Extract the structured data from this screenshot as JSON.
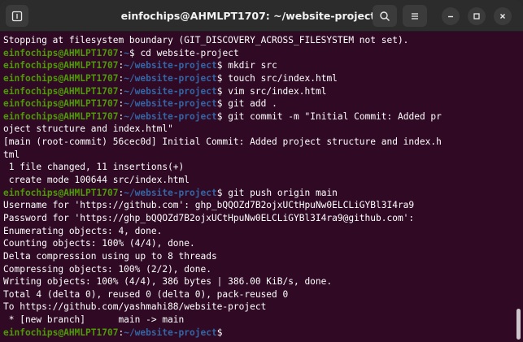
{
  "window": {
    "title": "einfochips@AHMLPT1707: ~/website-project",
    "icons": {
      "new_tab": "new-tab-icon",
      "search": "search-icon",
      "menu": "hamburger-menu-icon",
      "minimize": "minimize-icon",
      "maximize": "maximize-icon",
      "close": "close-icon"
    }
  },
  "colors": {
    "terminal_bg": "#300a24",
    "prompt_user": "#4e9a06",
    "prompt_path": "#3465a4",
    "text": "#ffffff"
  },
  "prompt": {
    "user_host": "einfochips@AHMLPT1707",
    "separator": ":",
    "path_home": "~",
    "path_project": "~/website-project",
    "dollar": "$ "
  },
  "terminal": {
    "lines": [
      {
        "text": "Stopping at filesystem boundary (GIT_DISCOVERY_ACROSS_FILESYSTEM not set)."
      },
      {
        "cmd": "cd website-project",
        "home": true
      },
      {
        "cmd": "mkdir src"
      },
      {
        "cmd": "touch src/index.html"
      },
      {
        "cmd": "vim src/index.html"
      },
      {
        "cmd": "git add ."
      },
      {
        "cmd": "git commit -m \"Initial Commit: Added pr"
      },
      {
        "text": "oject structure and index.html\""
      },
      {
        "text": "[main (root-commit) 56cec0d] Initial Commit: Added project structure and index.h"
      },
      {
        "text": "tml"
      },
      {
        "text": " 1 file changed, 11 insertions(+)"
      },
      {
        "text": " create mode 100644 src/index.html"
      },
      {
        "cmd": "git push origin main"
      },
      {
        "text": "Username for 'https://github.com': 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"
      },
      {
        "text": "Password for 'https://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@github.com':"
      },
      {
        "text": "Enumerating objects: 4, done."
      },
      {
        "text": "Counting objects: 100% (4/4), done."
      },
      {
        "text": "Delta compression using up to 8 threads"
      },
      {
        "text": "Compressing objects: 100% (2/2), done."
      },
      {
        "text": "Writing objects: 100% (4/4), 386 bytes | 386.00 KiB/s, done."
      },
      {
        "text": "Total 4 (delta 0), reused 0 (delta 0), pack-reused 0"
      },
      {
        "text": "To https://github.com/yashmahi88/website-project"
      },
      {
        "text": " * [new branch]      main -> main"
      },
      {
        "cmd": ""
      }
    ]
  }
}
